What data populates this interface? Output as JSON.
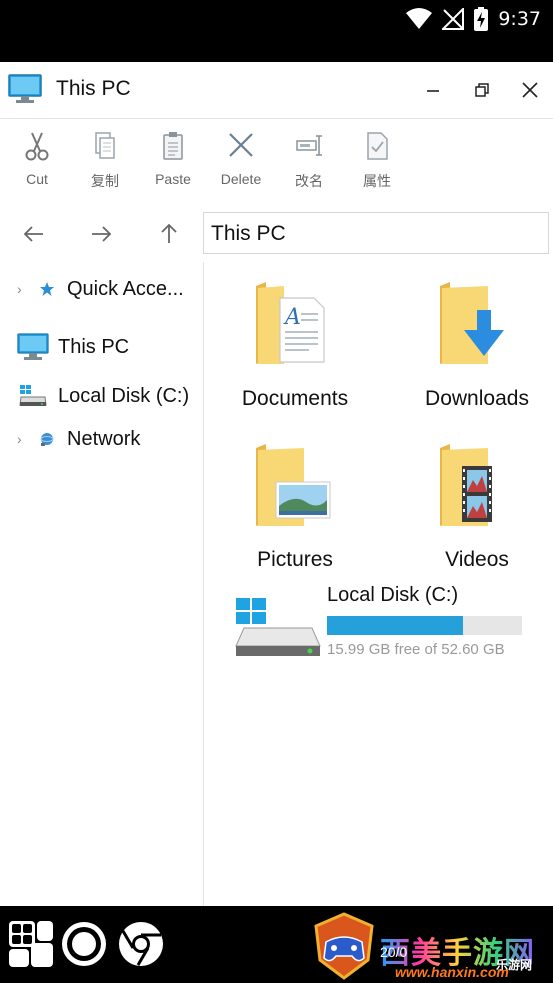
{
  "status_bar": {
    "time": "9:37"
  },
  "window": {
    "title": "This PC",
    "controls": [
      "minimize-icon",
      "restore-icon",
      "close-icon"
    ]
  },
  "ribbon": {
    "items": [
      {
        "label": "Cut",
        "icon": "scissors-icon"
      },
      {
        "label": "复制",
        "icon": "copy-icon"
      },
      {
        "label": "Paste",
        "icon": "clipboard-icon"
      },
      {
        "label": "Delete",
        "icon": "delete-x-icon"
      },
      {
        "label": "改名",
        "icon": "rename-icon"
      },
      {
        "label": "属性",
        "icon": "properties-icon"
      }
    ]
  },
  "navigation": {
    "address": "This PC",
    "buttons": [
      "back-arrow-icon",
      "forward-arrow-icon",
      "up-arrow-icon"
    ]
  },
  "sidebar": {
    "items": [
      {
        "label": "Quick Acce...",
        "icon": "pin-star-icon",
        "expandable": true
      },
      {
        "label": "This PC",
        "icon": "monitor-icon",
        "expandable": false
      },
      {
        "label": "Local Disk (C:)",
        "icon": "drive-icon",
        "expandable": false
      },
      {
        "label": "Network",
        "icon": "network-icon",
        "expandable": true
      }
    ]
  },
  "content": {
    "folders": [
      {
        "label": "Documents",
        "icon": "documents-folder-icon"
      },
      {
        "label": "Downloads",
        "icon": "downloads-folder-icon"
      },
      {
        "label": "Pictures",
        "icon": "pictures-folder-icon"
      },
      {
        "label": "Videos",
        "icon": "videos-folder-icon"
      }
    ],
    "drive": {
      "name": "Local Disk (C:)",
      "free_text": "15.99 GB free of 52.60 GB",
      "used_fraction": 0.696,
      "bar_color": "#26a0da"
    }
  },
  "taskbar": {
    "items": [
      "start-grid-icon",
      "circle-icon",
      "chrome-browser-icon"
    ],
    "watermark": {
      "text": "西美手游网",
      "url": "www.hanxin.com",
      "date": "20/0",
      "sub": "乐游网"
    }
  }
}
